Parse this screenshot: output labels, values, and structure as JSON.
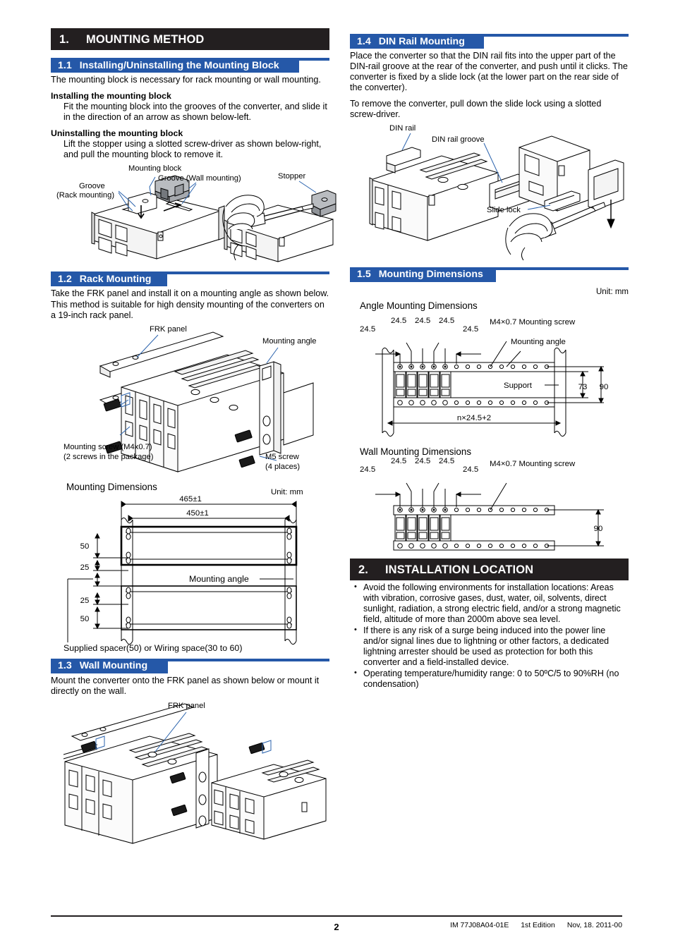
{
  "document": {
    "page_number": "2",
    "manual_code": "IM 77J08A04-01E",
    "edition": "1st Edition",
    "date": "Nov, 18. 2011-00"
  },
  "section1": {
    "number": "1.",
    "title": "MOUNTING METHOD",
    "sub1": {
      "number": "1.1",
      "title": "Installing/Uninstalling the Mounting Block",
      "intro": "The mounting block is necessary for rack mounting or wall mounting.",
      "install_heading": "Installing the mounting block",
      "install_text": "Fit the mounting block into the grooves of the converter, and slide it in the direction of an arrow as shown below-left.",
      "uninstall_heading": "Uninstalling the mounting block",
      "uninstall_text": "Lift the stopper using a slotted screw-driver as shown below-right, and pull the mounting block to remove it.",
      "figure_labels": {
        "mounting_block": "Mounting block",
        "groove_wall": "Groove (Wall mounting)",
        "groove_rack_line1": "Groove",
        "groove_rack_line2": "(Rack mounting)",
        "stopper": "Stopper"
      }
    },
    "sub2": {
      "number": "1.2",
      "title": "Rack Mounting",
      "intro": "Take the FRK panel and install it on a mounting angle as shown below. This method is suitable for high density mounting of the converters on a 19-inch rack panel.",
      "figure_labels": {
        "frk_panel": "FRK panel",
        "mounting_angle": "Mounting angle",
        "mounting_screw_line1": "Mounting screw (M4x0.7)",
        "mounting_screw_line2": "(2 screws in the package)",
        "m5_screw_line1": "M5 screw",
        "m5_screw_line2": "(4 places)"
      },
      "dimensions": {
        "caption": "Mounting Dimensions",
        "unit": "Unit: mm",
        "width_outer": "465±1",
        "width_inner": "450±1",
        "v1": "50",
        "v2": "25",
        "v3": "25",
        "v4": "50",
        "mounting_angle": "Mounting angle",
        "spacer_note": "Supplied spacer(50) or Wiring space(30 to 60)"
      }
    },
    "sub3": {
      "number": "1.3",
      "title": "Wall Mounting",
      "intro": "Mount the converter onto the FRK panel as shown below or mount it directly on the wall.",
      "figure_labels": {
        "frk_panel": "FRK panel"
      }
    },
    "sub4": {
      "number": "1.4",
      "title": "DIN Rail Mounting",
      "para1": "Place the converter so that the DIN rail fits into the upper part of the DIN-rail groove at the rear of the converter, and push until it clicks. The converter is fixed by a slide lock (at the lower part on the rear side of the converter).",
      "para2": "To remove the converter, pull down the slide lock using a slotted screw-driver.",
      "figure_labels": {
        "din_rail": "DIN rail",
        "din_rail_groove": "DIN rail groove",
        "slide_lock": "Slide lock"
      }
    },
    "sub5": {
      "number": "1.5",
      "title": "Mounting  Dimensions",
      "unit": "Unit: mm",
      "angle": {
        "caption": "Angle Mounting Dimensions",
        "pitch": "24.5",
        "pitch_left": "24.5",
        "pitch_right": "24.5",
        "screw_label": "M4×0.7 Mounting screw",
        "mounting_angle": "Mounting angle",
        "support": "Support",
        "dim_73": "73",
        "dim_90": "90",
        "total": "n×24.5+2"
      },
      "wall": {
        "caption": "Wall Mounting Dimensions",
        "pitch": "24.5",
        "screw_label": "M4×0.7 Mounting screw",
        "dim_90": "90"
      }
    }
  },
  "section2": {
    "number": "2.",
    "title": "INSTALLATION LOCATION",
    "bullets": [
      "Avoid the following environments for installation locations: Areas with vibration, corrosive gases, dust, water, oil, solvents, direct sunlight, radiation, a strong electric field, and/or a strong magnetic field, altitude of more than 2000m above sea level.",
      "If there is any risk of a surge being induced into the power line and/or signal lines due to lightning or other factors, a dedicated lightning arrester should be used as protection for both this converter and a field-installed device.",
      "Operating temperature/humidity range: 0 to 50ºC/5 to 90%RH (no condensation)"
    ]
  },
  "colors": {
    "header_dark": "#231f20",
    "header_blue": "#2558a8",
    "leader_blue": "#2b63ad",
    "module_fill": "#ffffff",
    "module_shade": "#e8e8e8"
  }
}
